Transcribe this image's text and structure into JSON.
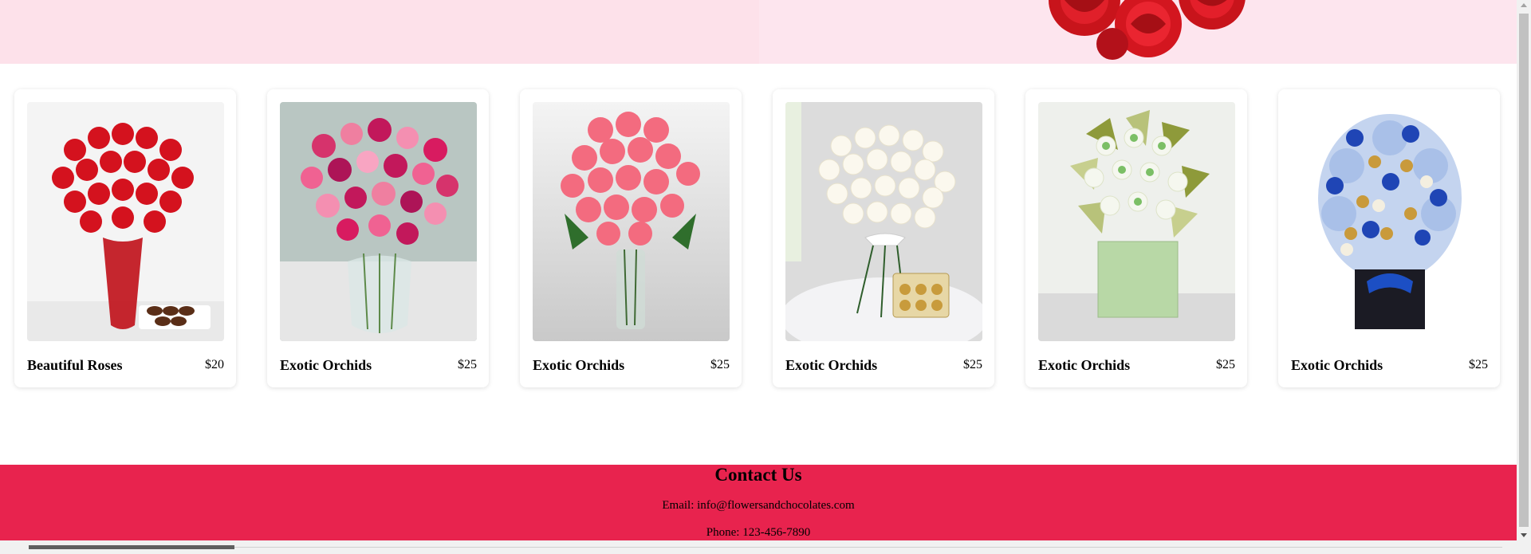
{
  "products": [
    {
      "name": "Beautiful Roses",
      "price": "$20",
      "image_icon": "red-roses-vase-icon"
    },
    {
      "name": "Exotic Orchids",
      "price": "$25",
      "image_icon": "pink-roses-vase-icon"
    },
    {
      "name": "Exotic Orchids",
      "price": "$25",
      "image_icon": "coral-roses-vase-icon"
    },
    {
      "name": "Exotic Orchids",
      "price": "$25",
      "image_icon": "white-roses-bouquet-icon"
    },
    {
      "name": "Exotic Orchids",
      "price": "$25",
      "image_icon": "green-chocolate-bouquet-icon"
    },
    {
      "name": "Exotic Orchids",
      "price": "$25",
      "image_icon": "blue-chocolate-bouquet-icon"
    }
  ],
  "contact": {
    "title": "Contact Us",
    "email": "Email: info@flowersandchocolates.com",
    "phone": "Phone: 123-456-7890"
  },
  "colors": {
    "hero_background": "#fde1ea",
    "footer_background": "#e8234e",
    "card_background": "#ffffff"
  }
}
